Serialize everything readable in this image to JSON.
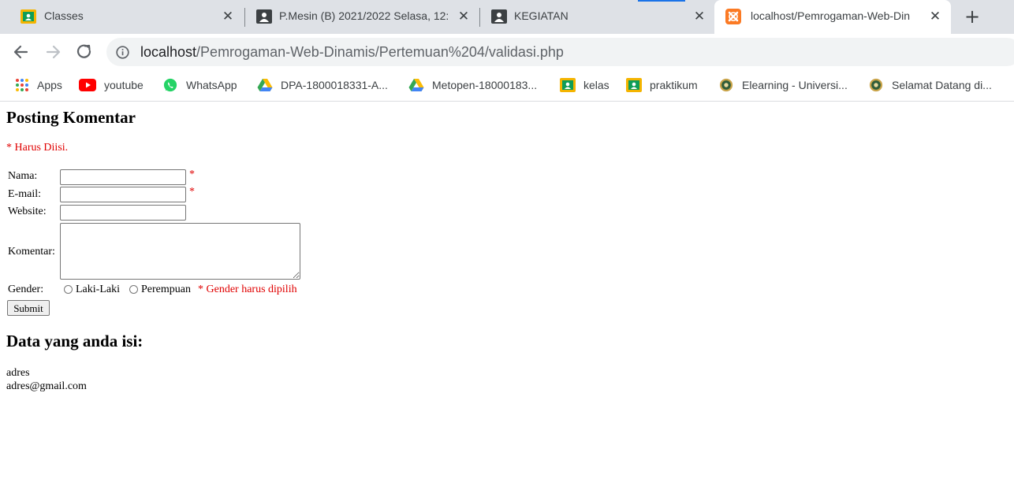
{
  "browser": {
    "tabs": [
      {
        "title": "Classes",
        "icon": "google-classroom-icon",
        "active": false
      },
      {
        "title": "P.Mesin (B) 2021/2022 Selasa, 12:",
        "icon": "meet-tile-icon",
        "active": false
      },
      {
        "title": "KEGIATAN",
        "icon": "meet-tile-icon",
        "active": false
      },
      {
        "title": "localhost/Pemrogaman-Web-Din",
        "icon": "xampp-icon",
        "active": true
      }
    ],
    "new_tab_label": "+",
    "url_host": "localhost",
    "url_path": "/Pemrogaman-Web-Dinamis/Pertemuan%204/validasi.php",
    "bookmarks": [
      {
        "label": "Apps",
        "icon": "apps-grid-icon"
      },
      {
        "label": "youtube",
        "icon": "youtube-icon"
      },
      {
        "label": "WhatsApp",
        "icon": "whatsapp-icon"
      },
      {
        "label": "DPA-1800018331-A...",
        "icon": "google-drive-icon"
      },
      {
        "label": "Metopen-18000183...",
        "icon": "google-drive-icon"
      },
      {
        "label": "kelas",
        "icon": "google-classroom-icon"
      },
      {
        "label": "praktikum",
        "icon": "google-classroom-icon"
      },
      {
        "label": "Elearning - Universi...",
        "icon": "university-seal-icon"
      },
      {
        "label": "Selamat Datang di...",
        "icon": "university-seal-icon"
      }
    ]
  },
  "page": {
    "heading": "Posting Komentar",
    "required_note": "* Harus Diisi.",
    "form": {
      "name_label": "Nama:",
      "name_value": "",
      "email_label": "E-mail:",
      "email_value": "",
      "website_label": "Website:",
      "website_value": "",
      "comment_label": "Komentar:",
      "comment_value": "",
      "required_mark": "*",
      "gender_label": "Gender:",
      "gender_options": [
        "Laki-Laki",
        "Perempuan"
      ],
      "gender_error": "* Gender harus dipilih",
      "submit_label": "Submit"
    },
    "output_heading": "Data yang anda isi:",
    "output_lines": [
      "adres",
      "adres@gmail.com"
    ]
  },
  "colors": {
    "error": "#e00000",
    "tabstrip": "#dee1e6",
    "omnibox": "#f1f3f4"
  }
}
